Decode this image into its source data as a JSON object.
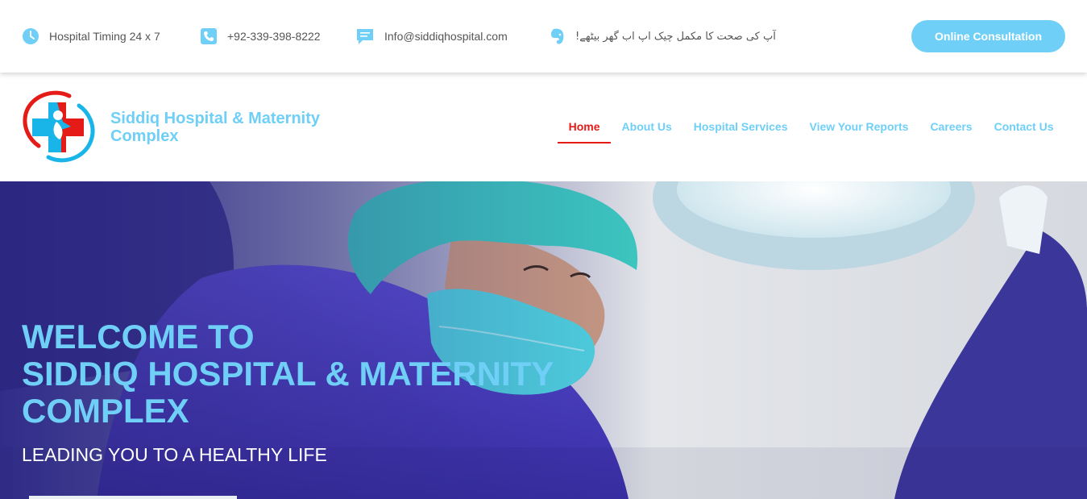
{
  "topbar": {
    "timing": {
      "icon": "clock-icon",
      "text": "Hospital Timing 24 x 7"
    },
    "phone": {
      "icon": "phone-icon",
      "text": "+92-339-398-8222"
    },
    "email": {
      "icon": "message-icon",
      "text": "Info@siddiqhospital.com"
    },
    "urdu": {
      "icon": "evernote-icon",
      "text": "آپ کی صحت کا مکمل چیک اپ اب گھر بیٹھے!"
    },
    "cta_label": "Online Consultation"
  },
  "header": {
    "brand_line1": "Siddiq Hospital & Maternity",
    "brand_line2": "Complex",
    "nav": [
      {
        "label": "Home",
        "active": true
      },
      {
        "label": "About Us"
      },
      {
        "label": "Hospital Services"
      },
      {
        "label": "View Your Reports"
      },
      {
        "label": "Careers"
      },
      {
        "label": "Contact Us"
      }
    ]
  },
  "hero": {
    "title_line1": "WELCOME TO",
    "title_line2": "SIDDIQ HOSPITAL & MATERNITY",
    "title_line3": "COMPLEX",
    "subtitle": "LEADING YOU TO A HEALTHY LIFE"
  },
  "colors": {
    "accent": "#6fcff7",
    "active_nav": "#e41b17",
    "scrubs": "#4b3fc2",
    "cap": "#36c6be"
  }
}
